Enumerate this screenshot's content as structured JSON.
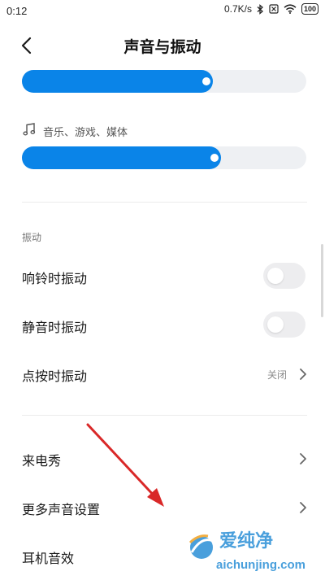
{
  "status_bar": {
    "time": "0:12",
    "speed": "0.7K/s",
    "battery": "100"
  },
  "header": {
    "title": "声音与振动"
  },
  "volume": {
    "top_slider_level": 0.67,
    "media_label": "音乐、游戏、媒体",
    "media_slider_level": 0.7
  },
  "vibration": {
    "section_title": "振动",
    "ring_vibrate_label": "响铃时振动",
    "silent_vibrate_label": "静音时振动",
    "touch_vibrate_label": "点按时振动",
    "touch_vibrate_value": "关闭"
  },
  "more": {
    "ringtone_show_label": "来电秀",
    "more_sound_label": "更多声音设置",
    "earphone_label": "耳机音效"
  },
  "watermark": {
    "line1": "爱纯净",
    "line2": "aichunjing.com"
  },
  "colors": {
    "accent": "#0a84e8",
    "annotation_arrow": "#d92828"
  }
}
